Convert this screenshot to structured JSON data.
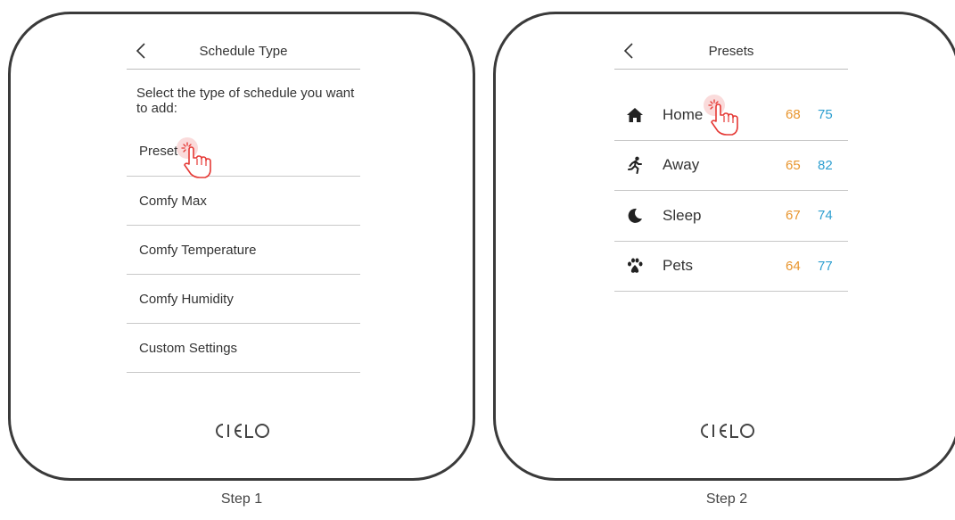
{
  "step1": {
    "caption": "Step 1",
    "header": {
      "title": "Schedule Type",
      "back_icon": "chevron-left-icon"
    },
    "prompt": "Select the type of schedule you want to add:",
    "options": [
      {
        "label": "Preset"
      },
      {
        "label": "Comfy Max"
      },
      {
        "label": "Comfy Temperature"
      },
      {
        "label": "Comfy Humidity"
      },
      {
        "label": "Custom Settings"
      }
    ],
    "logo": "CIELO"
  },
  "step2": {
    "caption": "Step 2",
    "header": {
      "title": "Presets",
      "back_icon": "chevron-left-icon"
    },
    "presets": [
      {
        "name": "Home",
        "icon": "home-icon",
        "low": "68",
        "high": "75"
      },
      {
        "name": "Away",
        "icon": "running-person-icon",
        "low": "65",
        "high": "82"
      },
      {
        "name": "Sleep",
        "icon": "moon-icon",
        "low": "67",
        "high": "74"
      },
      {
        "name": "Pets",
        "icon": "paw-icon",
        "low": "64",
        "high": "77"
      }
    ],
    "logo": "CIELO"
  },
  "colors": {
    "low_temp": "#e8952e",
    "high_temp": "#2e9fd0",
    "tap_indicator": "#e53935"
  }
}
